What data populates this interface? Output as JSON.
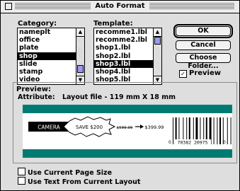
{
  "window": {
    "title": "Auto Format"
  },
  "category": {
    "label": "Category:",
    "items": [
      "nameplt",
      "office",
      "plate",
      "shop",
      "slide",
      "stamp",
      "video"
    ],
    "selected_index": 3
  },
  "template": {
    "label": "Template:",
    "items": [
      "recomme1.lbl",
      "recomme2.lbl",
      "shop1.lbl",
      "shop2.lbl",
      "shop3.lbl",
      "shop4.lbl",
      "shop5.lbl"
    ],
    "selected_index": 4
  },
  "buttons": {
    "ok": "OK",
    "cancel": "Cancel",
    "choose_folder": "Choose Folder..."
  },
  "preview_toggle": {
    "label": "Preview",
    "checked": true
  },
  "preview": {
    "heading": "Preview:",
    "attribute_label": "Attribute:",
    "attribute_value": "Layout file - 119 mm X 18 mm",
    "label_content": {
      "brand": "CAMERA",
      "promo": "SAVE $200",
      "old_price": "$599.99",
      "new_price": "$399.99",
      "barcode_digits": "70382 20975",
      "barcode_left": "0",
      "barcode_right": "0"
    }
  },
  "options": {
    "use_page_size": {
      "label": "Use Current Page Size",
      "checked": false
    },
    "use_text_layout": {
      "label": "Use Text From Current Layout",
      "checked": false
    }
  },
  "colors": {
    "teal": "#007b73",
    "scroll_thumb": "#9a9af0"
  }
}
